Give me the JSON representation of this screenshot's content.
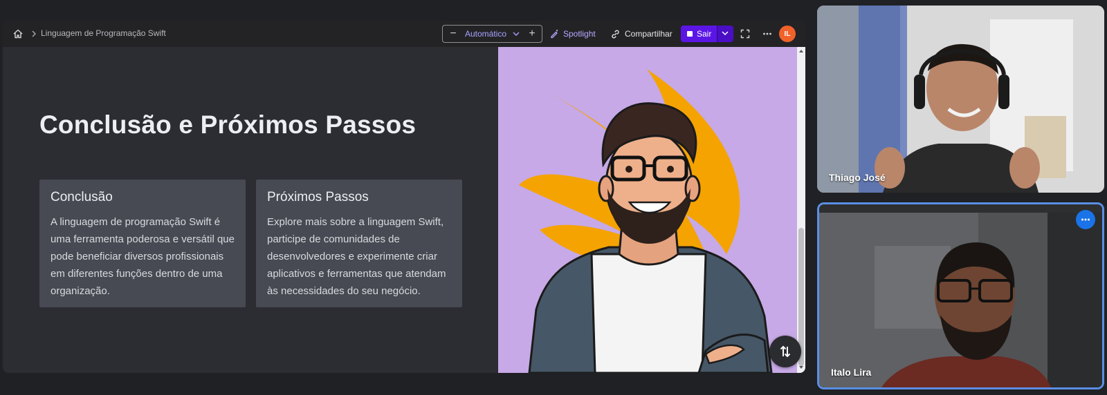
{
  "toolbar": {
    "breadcrumb": "Linguagem de Programação Swift",
    "zoom_label": "Automático",
    "zoom_minus": "−",
    "zoom_plus": "+",
    "spotlight_label": "Spotlight",
    "share_label": "Compartilhar",
    "exit_label": "Sair",
    "avatar_initials": "IL"
  },
  "slide": {
    "title": "Conclusão e Próximos Passos",
    "cards": [
      {
        "heading": "Conclusão",
        "body": "A linguagem de programação Swift é uma ferramenta poderosa e versátil que pode beneficiar diversos profissionais em diferentes funções dentro de uma organização."
      },
      {
        "heading": "Próximos Passos",
        "body": "Explore mais sobre a linguagem Swift, participe de comunidades de desenvolvedores e experimente criar aplicativos e ferramentas que atendam às necessidades do seu negócio."
      }
    ]
  },
  "participants": [
    {
      "name": "Thiago José"
    },
    {
      "name": "Italo Lira"
    }
  ],
  "icons": {
    "home": "home-icon",
    "breadcrumb_separator": "chevron-right-icon",
    "zoom_caret": "chevron-down-icon",
    "spotlight": "pen-sparkle-icon",
    "share": "link-icon",
    "exit": "stop-square-icon",
    "exit_menu": "chevron-down-icon",
    "fullscreen": "fullscreen-icon",
    "more": "more-horizontal-icon",
    "swap": "swap-vertical-icon",
    "tile_more": "more-horizontal-icon"
  },
  "colors": {
    "accent_purple": "#5b16e6",
    "avatar_orange": "#f1622a",
    "active_tile_border": "#5a8fe6",
    "slide_image_bg": "#c6a9e6",
    "swift_orange": "#f5a300"
  }
}
